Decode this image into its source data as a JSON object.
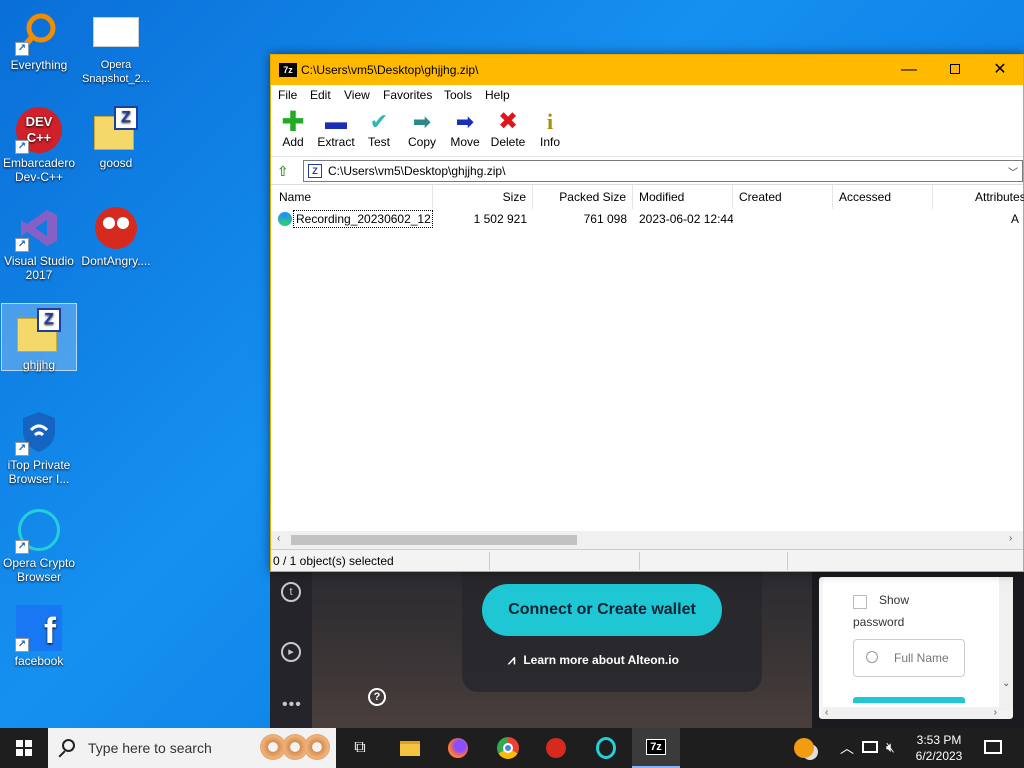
{
  "desktop": {
    "icons": [
      {
        "label": "Everything"
      },
      {
        "label": "Opera Snapshot_2..."
      },
      {
        "label": "Embarcadero Dev-C++"
      },
      {
        "label": "goosd"
      },
      {
        "label": "Visual Studio 2017"
      },
      {
        "label": "DontAngry...."
      },
      {
        "label": "ghjjhg"
      },
      {
        "label": "iTop Private Browser I..."
      },
      {
        "label": "Opera Crypto Browser"
      },
      {
        "label": "facebook"
      }
    ]
  },
  "window": {
    "title": "C:\\Users\\vm5\\Desktop\\ghjjhg.zip\\",
    "app_icon_text": "7z",
    "menu": [
      "File",
      "Edit",
      "View",
      "Favorites",
      "Tools",
      "Help"
    ],
    "toolbar": [
      {
        "label": "Add",
        "icon": "add-icon"
      },
      {
        "label": "Extract",
        "icon": "extract-icon"
      },
      {
        "label": "Test",
        "icon": "test-icon"
      },
      {
        "label": "Copy",
        "icon": "copy-icon"
      },
      {
        "label": "Move",
        "icon": "move-icon"
      },
      {
        "label": "Delete",
        "icon": "delete-icon"
      },
      {
        "label": "Info",
        "icon": "info-icon"
      }
    ],
    "address": "C:\\Users\\vm5\\Desktop\\ghjjhg.zip\\",
    "columns": [
      "Name",
      "Size",
      "Packed Size",
      "Modified",
      "Created",
      "Accessed",
      "Attributes"
    ],
    "rows": [
      {
        "name": "Recording_20230602_12...",
        "size": "1 502 921",
        "packed": "761 098",
        "modified": "2023-06-02 12:44",
        "created": "",
        "accessed": "",
        "attributes": "A"
      }
    ],
    "status": "0 / 1 object(s) selected"
  },
  "background_browser": {
    "wallet_button": "Connect or Create wallet",
    "learn_more": "Learn more about Alteon.io",
    "show_password_1": "Show",
    "show_password_2": "password",
    "full_name_placeholder": "Full Name"
  },
  "taskbar": {
    "search_placeholder": "Type here to search",
    "time": "3:53 PM",
    "date": "6/2/2023"
  },
  "colors": {
    "titlebar": "#ffba00",
    "wallet_accent": "#1fc7d4",
    "desktop": "#1590f0"
  }
}
